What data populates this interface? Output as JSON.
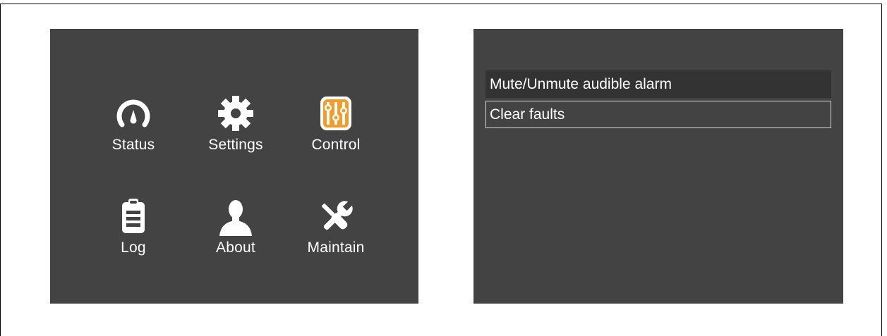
{
  "main_menu": {
    "items": [
      {
        "label": "Status",
        "icon": "gauge-icon"
      },
      {
        "label": "Settings",
        "icon": "gear-icon"
      },
      {
        "label": "Control",
        "icon": "sliders-icon"
      },
      {
        "label": "Log",
        "icon": "clipboard-icon"
      },
      {
        "label": "About",
        "icon": "person-icon"
      },
      {
        "label": "Maintain",
        "icon": "tools-icon"
      }
    ]
  },
  "control_menu": {
    "items": [
      {
        "label": "Mute/Unmute audible alarm",
        "state": "highlighted"
      },
      {
        "label": "Clear faults",
        "state": "selected"
      }
    ]
  },
  "colors": {
    "panel_background": "#434343",
    "highlight_row": "#333333",
    "accent": "#f39c2a",
    "text": "#ffffff"
  }
}
